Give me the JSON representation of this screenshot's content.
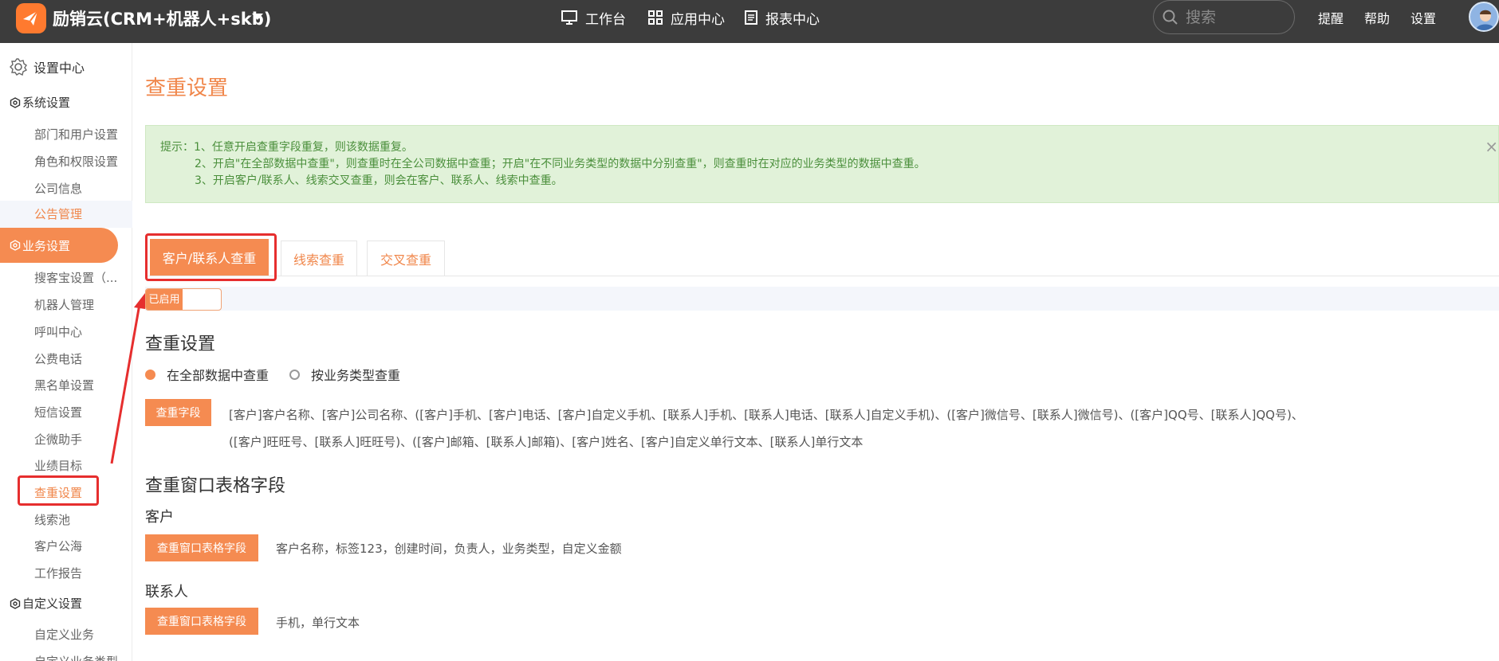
{
  "header": {
    "brand": "励销云(CRM+机器人+skb)",
    "nav": [
      {
        "label": "工作台",
        "icon": "monitor-icon"
      },
      {
        "label": "应用中心",
        "icon": "grid-icon"
      },
      {
        "label": "报表中心",
        "icon": "report-icon"
      }
    ],
    "search_placeholder": "搜索",
    "links": [
      "提醒",
      "帮助",
      "设置"
    ]
  },
  "sidebar": {
    "title": "设置中心",
    "groups": [
      {
        "label": "系统设置",
        "items": [
          "部门和用户设置",
          "角色和权限设置",
          "公司信息",
          "公告管理"
        ]
      },
      {
        "label": "业务设置",
        "items": [
          "搜客宝设置（...",
          "机器人管理",
          "呼叫中心",
          "公费电话",
          "黑名单设置",
          "短信设置",
          "企微助手",
          "业绩目标",
          "查重设置",
          "线索池",
          "客户公海",
          "工作报告"
        ]
      },
      {
        "label": "自定义设置",
        "items": [
          "自定义业务",
          "自定义业务类型"
        ]
      }
    ]
  },
  "main": {
    "title": "查重设置",
    "alert": {
      "line1": "提示：1、任意开启查重字段重复，则该数据重复。",
      "line2": "2、开启\"在全部数据中查重\"，则查重时在全公司数据中查重；开启\"在不同业务类型的数据中分别查重\"，则查重时在对应的业务类型的数据中查重。",
      "line3": "3、开启客户/联系人、线索交叉查重，则会在客户、联系人、线索中查重。",
      "close": "×"
    },
    "tabs": [
      "客户/联系人查重",
      "线索查重",
      "交叉查重"
    ],
    "switch_label": "已启用",
    "dedup_heading": "查重设置",
    "radio_options": [
      "在全部数据中查重",
      "按业务类型查重"
    ],
    "fields_button": "查重字段",
    "fields_text": "[客户]客户名称、[客户]公司名称、([客户]手机、[客户]电话、[客户]自定义手机、[联系人]手机、[联系人]电话、[联系人]自定义手机)、([客户]微信号、[联系人]微信号)、([客户]QQ号、[联系人]QQ号)、([客户]旺旺号、[联系人]旺旺号)、([客户]邮箱、[联系人]邮箱)、[客户]姓名、[客户]自定义单行文本、[联系人]单行文本",
    "window_heading": "查重窗口表格字段",
    "customer_label": "客户",
    "customer_button": "查重窗口表格字段",
    "customer_fields": "客户名称，标签123，创建时间，负责人，业务类型，自定义金额",
    "contact_label": "联系人",
    "contact_button": "查重窗口表格字段",
    "contact_fields": "手机，单行文本"
  },
  "colors": {
    "accent": "#f58b51",
    "topbar": "#3c3c3c",
    "alert_bg": "#e1f2d9",
    "annotation": "#e62e2e"
  }
}
